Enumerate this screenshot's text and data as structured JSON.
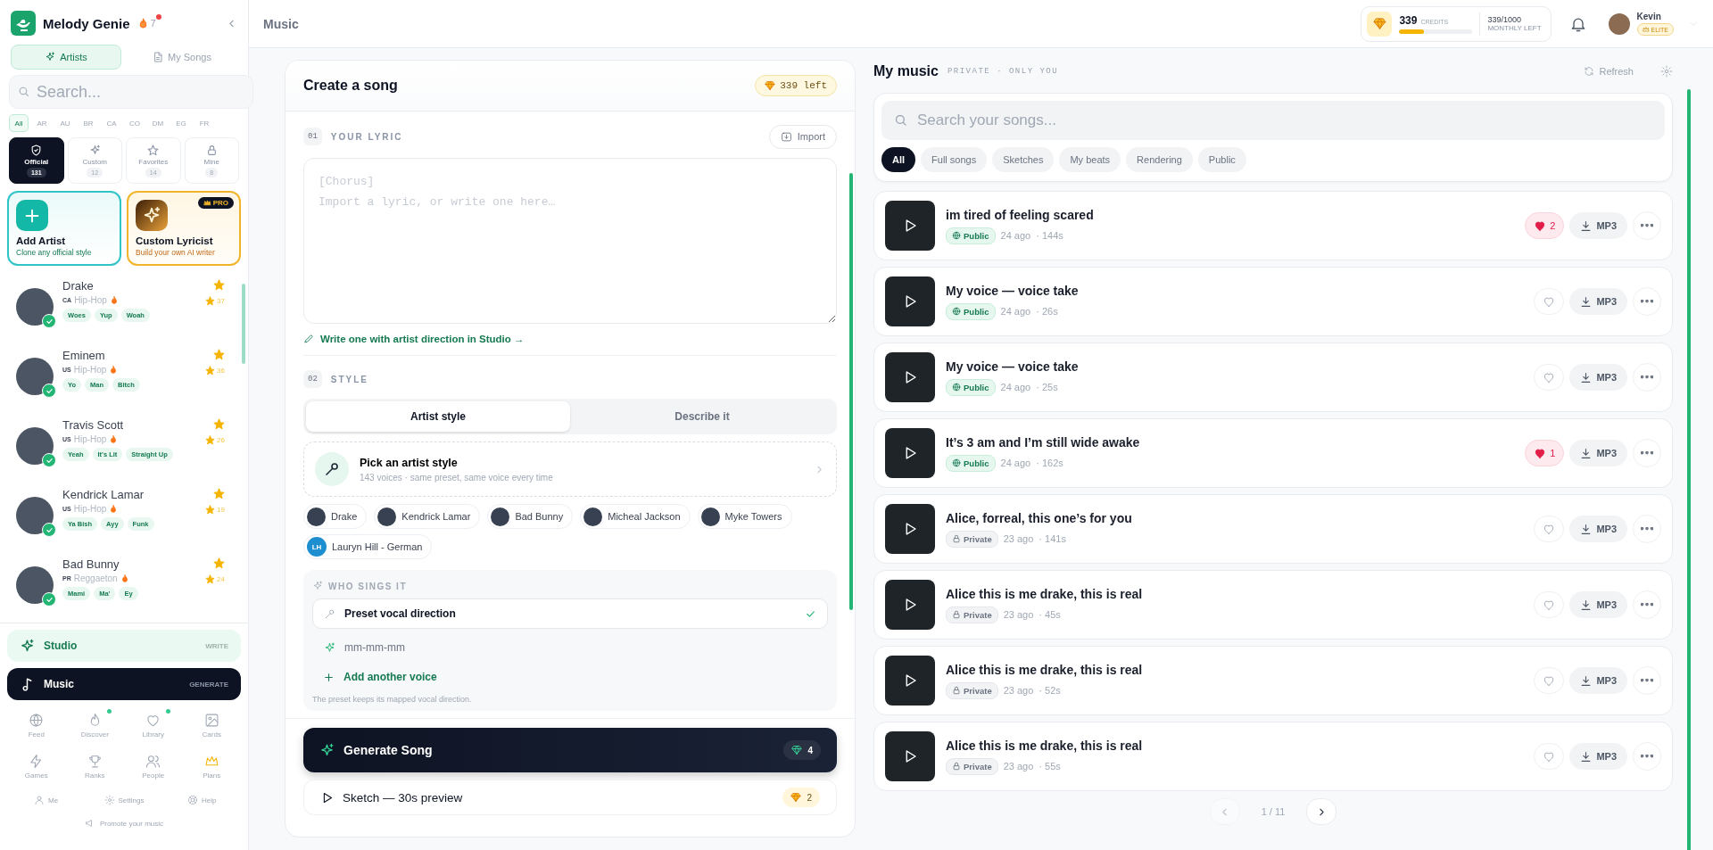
{
  "app": {
    "name": "Melody Genie",
    "streak": "7",
    "streak_alert": true
  },
  "sidebar": {
    "tabs": [
      {
        "label": "Artists",
        "selected": true
      },
      {
        "label": "My Songs",
        "selected": false
      }
    ],
    "search": {
      "placeholder": "Search..."
    },
    "countries": [
      {
        "label": "All",
        "selected": true
      },
      {
        "label": "AR",
        "selected": false
      },
      {
        "label": "AU",
        "selected": false
      },
      {
        "label": "BR",
        "selected": false
      },
      {
        "label": "CA",
        "selected": false
      },
      {
        "label": "CO",
        "selected": false
      },
      {
        "label": "DM",
        "selected": false
      },
      {
        "label": "EG",
        "selected": false
      },
      {
        "label": "FR",
        "selected": false
      }
    ],
    "filters": [
      {
        "label": "Official",
        "count": "131",
        "selected": true
      },
      {
        "label": "Custom",
        "count": "12",
        "selected": false
      },
      {
        "label": "Favorites",
        "count": "14",
        "selected": false
      },
      {
        "label": "Mine",
        "count": "8",
        "selected": false
      }
    ],
    "promo_cards": [
      {
        "kind": "add",
        "title": "Add Artist",
        "subtitle": "Clone any official style"
      },
      {
        "kind": "pro",
        "title": "Custom Lyricist",
        "subtitle": "Build your own AI writer",
        "badge": "PRO"
      }
    ],
    "artists": [
      {
        "name": "Drake",
        "country": "CA",
        "genre": "Hip-Hop",
        "hot": true,
        "verified": true,
        "favorite": true,
        "count": "37",
        "tags": [
          "Woes",
          "Yup",
          "Woah"
        ]
      },
      {
        "name": "Eminem",
        "country": "US",
        "genre": "Hip-Hop",
        "hot": true,
        "verified": true,
        "favorite": true,
        "count": "36",
        "tags": [
          "Yo",
          "Man",
          "Bitch"
        ]
      },
      {
        "name": "Travis Scott",
        "country": "US",
        "genre": "Hip-Hop",
        "hot": true,
        "verified": true,
        "favorite": true,
        "count": "26",
        "tags": [
          "Yeah",
          "It's Lit",
          "Straight Up"
        ]
      },
      {
        "name": "Kendrick Lamar",
        "country": "US",
        "genre": "Hip-Hop",
        "hot": true,
        "verified": true,
        "favorite": true,
        "count": "19",
        "tags": [
          "Ya Bish",
          "Ayy",
          "Funk"
        ]
      },
      {
        "name": "Bad Bunny",
        "country": "PR",
        "genre": "Reggaeton",
        "hot": true,
        "verified": true,
        "favorite": true,
        "count": "24",
        "tags": [
          "Mami",
          "Ma'",
          "Ey"
        ]
      }
    ],
    "modes": [
      {
        "label": "Studio",
        "hint": "WRITE",
        "selected": false
      },
      {
        "label": "Music",
        "hint": "GENERATE",
        "selected": true
      }
    ],
    "nav": [
      {
        "label": "Feed",
        "dot": false
      },
      {
        "label": "Discover",
        "dot": true
      },
      {
        "label": "Library",
        "dot": true
      },
      {
        "label": "Cards",
        "dot": false
      },
      {
        "label": "Games",
        "dot": false
      },
      {
        "label": "Ranks",
        "dot": false
      },
      {
        "label": "People",
        "dot": false
      },
      {
        "label": "Plans",
        "dot": false
      }
    ],
    "footer_links": [
      "Me",
      "Settings",
      "Help"
    ],
    "promote": "Promote your music"
  },
  "header": {
    "title": "Music",
    "credits": {
      "amount": "339",
      "label": "CREDITS",
      "level": 0.34,
      "monthly": "339/1000",
      "monthly_label": "MONTHLY LEFT"
    },
    "user": {
      "name": "Kevin",
      "tier": "ELITE"
    }
  },
  "create": {
    "title": "Create a song",
    "left": "339 left",
    "lyric": {
      "step": "01",
      "label": "YOUR LYRIC",
      "import": "Import",
      "placeholder": "[Chorus]\nImport a lyric, or write one here…",
      "studio_link": "Write one with artist direction in Studio →"
    },
    "style": {
      "step": "02",
      "label": "STYLE",
      "tabs": [
        {
          "label": "Artist style",
          "selected": true
        },
        {
          "label": "Describe it",
          "selected": false
        }
      ],
      "picker": {
        "title": "Pick an artist style",
        "subtitle": "143 voices · same preset, same voice every time"
      },
      "chips": [
        {
          "name": "Drake"
        },
        {
          "name": "Kendrick Lamar"
        },
        {
          "name": "Bad Bunny"
        },
        {
          "name": "Micheal Jackson"
        },
        {
          "name": "Myke Towers"
        },
        {
          "name": "Lauryn Hill - German",
          "initials": "LH"
        }
      ]
    },
    "singers": {
      "label": "WHO SINGS IT",
      "options": [
        {
          "label": "Preset vocal direction",
          "selected": true
        },
        {
          "label": "mm-mm-mm",
          "selected": false
        }
      ],
      "add": "Add another voice",
      "note": "The preset keeps its mapped vocal direction."
    },
    "generate": {
      "label": "Generate Song",
      "cost": "4"
    },
    "sketch": {
      "label": "Sketch — 30s preview",
      "cost": "2"
    }
  },
  "music": {
    "title": "My music",
    "subtitle": "PRIVATE · ONLY YOU",
    "refresh": "Refresh",
    "search": {
      "placeholder": "Search your songs..."
    },
    "filters": [
      {
        "label": "All",
        "selected": true
      },
      {
        "label": "Full songs",
        "selected": false
      },
      {
        "label": "Sketches",
        "selected": false
      },
      {
        "label": "My beats",
        "selected": false
      },
      {
        "label": "Rendering",
        "selected": false
      },
      {
        "label": "Public",
        "selected": false
      }
    ],
    "songs": [
      {
        "title": "im tired of feeling scared",
        "public": true,
        "visibility": "Public",
        "age": "24 ago",
        "duration": "· 144s",
        "liked": true,
        "likes": "2",
        "format": "MP3"
      },
      {
        "title": "My voice — voice take",
        "public": true,
        "visibility": "Public",
        "age": "24 ago",
        "duration": "· 26s",
        "liked": false,
        "format": "MP3"
      },
      {
        "title": "My voice — voice take",
        "public": true,
        "visibility": "Public",
        "age": "24 ago",
        "duration": "· 25s",
        "liked": false,
        "format": "MP3"
      },
      {
        "title": "It’s 3 am and I’m still wide awake",
        "public": true,
        "visibility": "Public",
        "age": "24 ago",
        "duration": "· 162s",
        "liked": true,
        "likes": "1",
        "format": "MP3"
      },
      {
        "title": "Alice, forreal, this one’s for you",
        "public": false,
        "visibility": "Private",
        "age": "23 ago",
        "duration": "· 141s",
        "liked": false,
        "format": "MP3"
      },
      {
        "title": "Alice this is me drake, this is real",
        "public": false,
        "visibility": "Private",
        "age": "23 ago",
        "duration": "· 45s",
        "liked": false,
        "format": "MP3"
      },
      {
        "title": "Alice this is me drake, this is real",
        "public": false,
        "visibility": "Private",
        "age": "23 ago",
        "duration": "· 52s",
        "liked": false,
        "format": "MP3"
      },
      {
        "title": "Alice this is me drake, this is real",
        "public": false,
        "visibility": "Private",
        "age": "23 ago",
        "duration": "· 55s",
        "liked": false,
        "format": "MP3"
      }
    ],
    "pagination": {
      "page": "1 / 11",
      "prev_disabled": true
    }
  }
}
